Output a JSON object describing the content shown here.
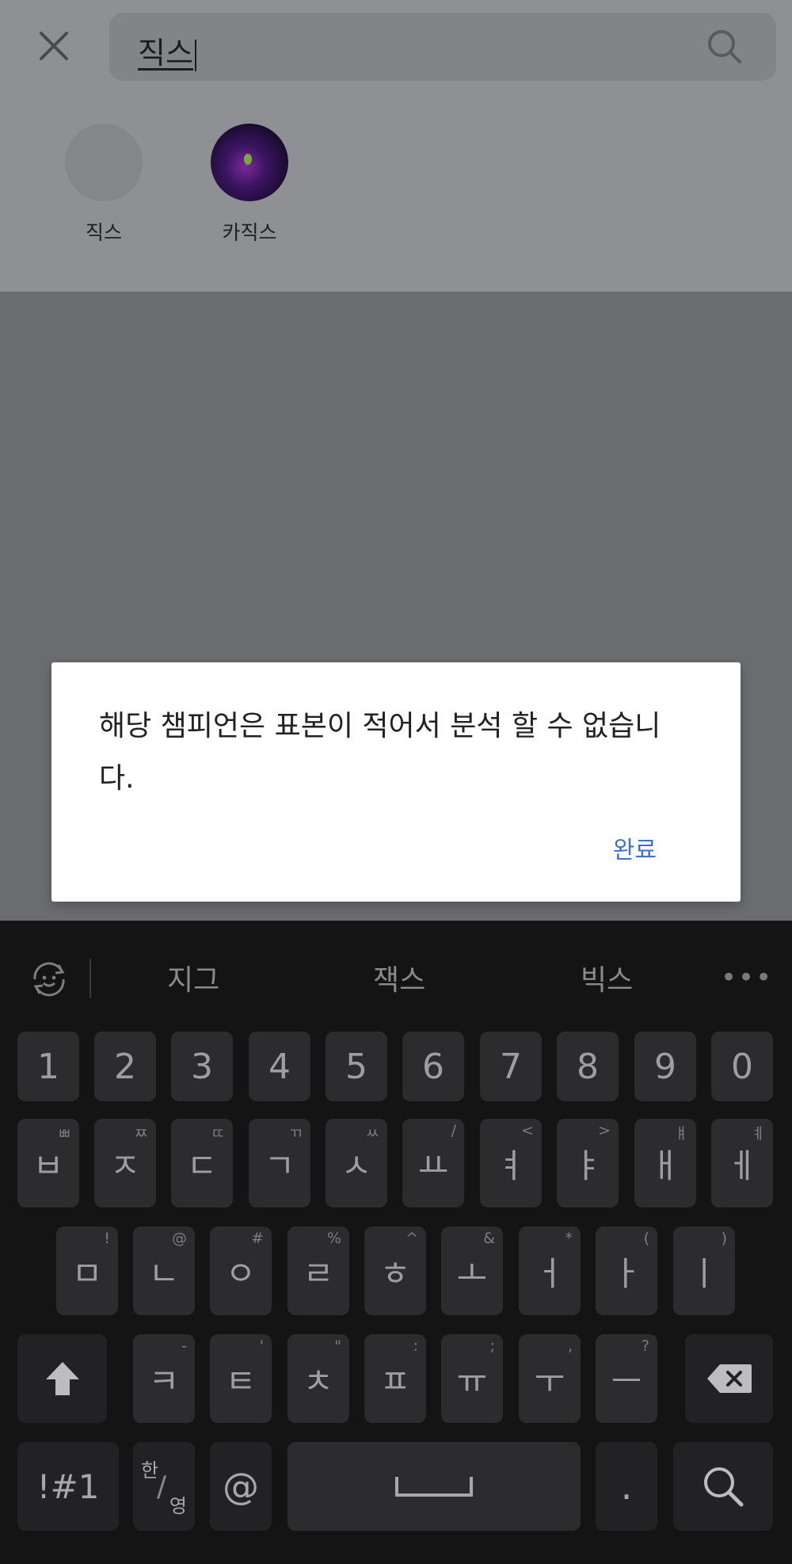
{
  "search": {
    "query": "직스",
    "close_icon": "close-icon",
    "search_icon": "search-icon"
  },
  "results": [
    {
      "label": "직스",
      "avatar": "empty"
    },
    {
      "label": "카직스",
      "avatar": "champion-portrait"
    }
  ],
  "dialog": {
    "message": "해당 챔피언은 표본이 적어서 분석 할 수 없습니다.",
    "confirm_label": "완료"
  },
  "keyboard": {
    "suggestions": [
      "지그",
      "잭스",
      "빅스"
    ],
    "more_label": "•••",
    "number_row": [
      "1",
      "2",
      "3",
      "4",
      "5",
      "6",
      "7",
      "8",
      "9",
      "0"
    ],
    "row1": [
      {
        "main": "ㅂ",
        "sub": "ㅃ"
      },
      {
        "main": "ㅈ",
        "sub": "ㅉ"
      },
      {
        "main": "ㄷ",
        "sub": "ㄸ"
      },
      {
        "main": "ㄱ",
        "sub": "ㄲ"
      },
      {
        "main": "ㅅ",
        "sub": "ㅆ"
      },
      {
        "main": "ㅛ",
        "sub": "/"
      },
      {
        "main": "ㅕ",
        "sub": "<"
      },
      {
        "main": "ㅑ",
        "sub": ">"
      },
      {
        "main": "ㅐ",
        "sub": "ㅒ"
      },
      {
        "main": "ㅔ",
        "sub": "ㅖ"
      }
    ],
    "row2": [
      {
        "main": "ㅁ",
        "sub": "!"
      },
      {
        "main": "ㄴ",
        "sub": "@"
      },
      {
        "main": "ㅇ",
        "sub": "#"
      },
      {
        "main": "ㄹ",
        "sub": "%"
      },
      {
        "main": "ㅎ",
        "sub": "^"
      },
      {
        "main": "ㅗ",
        "sub": "&"
      },
      {
        "main": "ㅓ",
        "sub": "*"
      },
      {
        "main": "ㅏ",
        "sub": "("
      },
      {
        "main": "ㅣ",
        "sub": ")"
      }
    ],
    "row3": [
      {
        "main": "ㅋ",
        "sub": "-"
      },
      {
        "main": "ㅌ",
        "sub": "'"
      },
      {
        "main": "ㅊ",
        "sub": "\""
      },
      {
        "main": "ㅍ",
        "sub": ":"
      },
      {
        "main": "ㅠ",
        "sub": ";"
      },
      {
        "main": "ㅜ",
        "sub": ","
      },
      {
        "main": "ㅡ",
        "sub": "?"
      }
    ],
    "symbols_label": "!#1",
    "lang_top": "한",
    "lang_bottom": "영",
    "at_label": "@",
    "period_label": "."
  }
}
